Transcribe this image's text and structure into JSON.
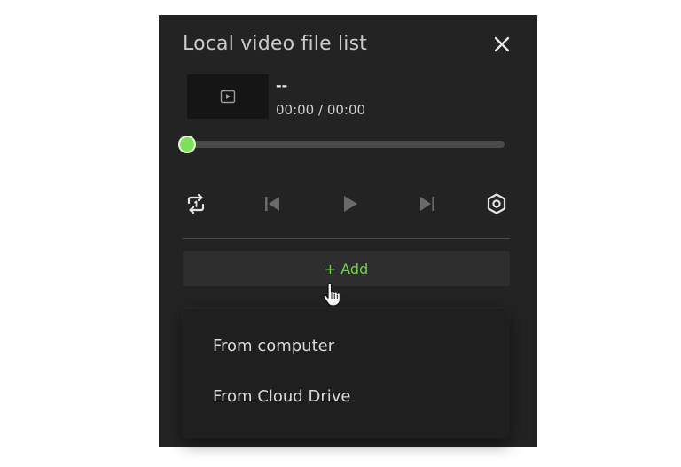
{
  "panel": {
    "title": "Local video file list"
  },
  "media": {
    "name": "--",
    "time": "00:00 / 00:00",
    "progress": 0.0
  },
  "controls": {
    "icons": [
      "repeat-one-icon",
      "skip-previous-icon",
      "play-icon",
      "skip-next-icon",
      "settings-icon"
    ]
  },
  "add": {
    "label": "+ Add"
  },
  "menu": {
    "items": [
      {
        "label": "From computer"
      },
      {
        "label": "From Cloud Drive"
      }
    ]
  },
  "colors": {
    "panel_bg": "#232323",
    "accent": "#6fd84a",
    "text": "#d9d9d9"
  }
}
